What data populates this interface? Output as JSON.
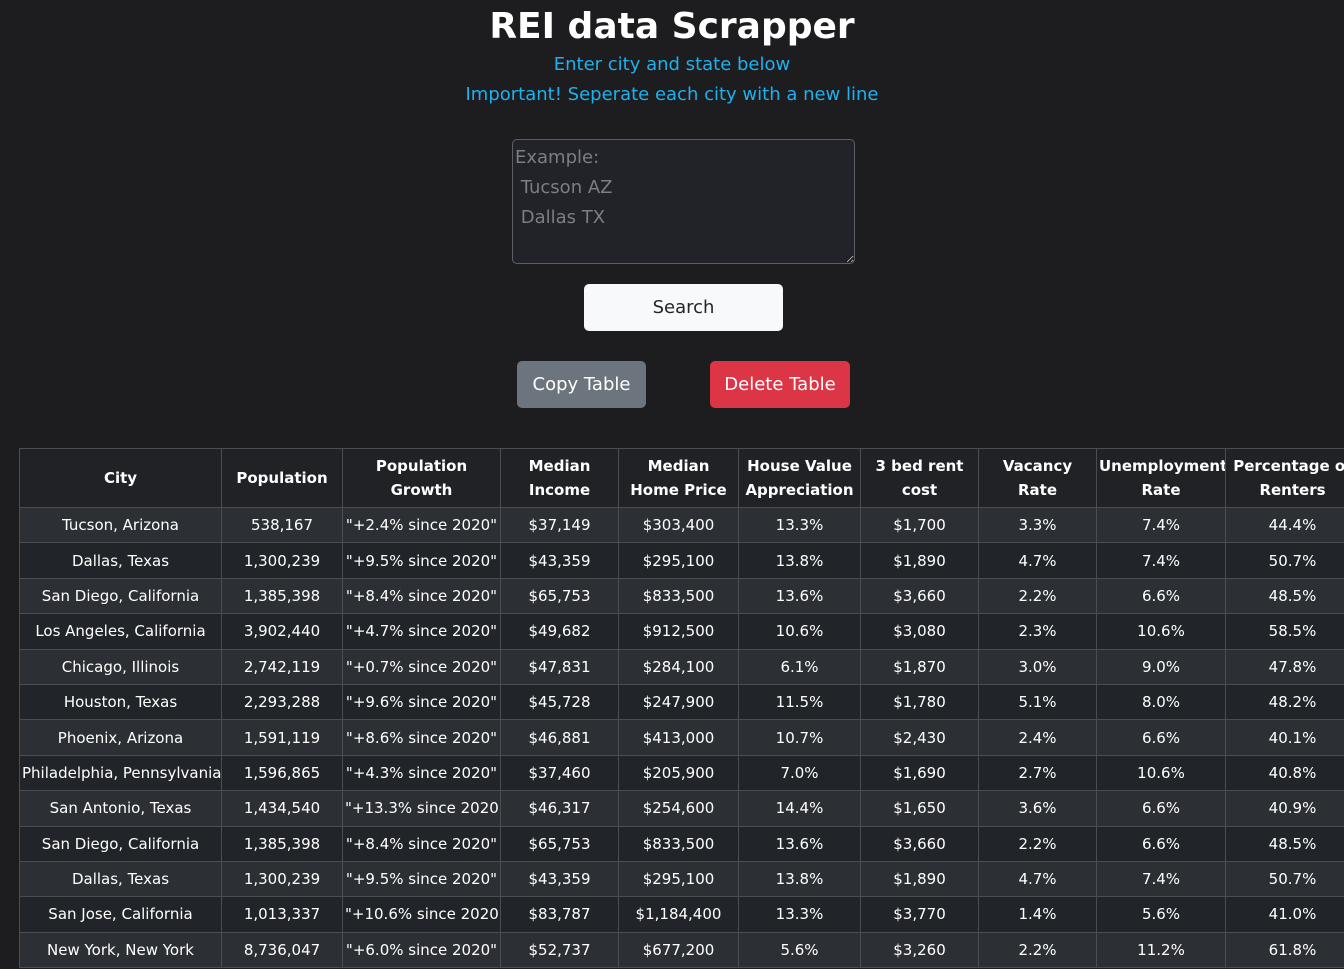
{
  "header": {
    "title": "REI data Scrapper",
    "subtitle": "Enter city and state below",
    "instruction": "Important! Seperate each city with a new line"
  },
  "input": {
    "value": "",
    "placeholder": "Example:\n Tucson AZ\n Dallas TX"
  },
  "buttons": {
    "search": "Search",
    "copy": "Copy Table",
    "delete": "Delete Table"
  },
  "colors": {
    "accent": "#1fb1ee",
    "copy_button": "#6c757d",
    "delete_button": "#dc3545",
    "search_button": "#f8f9fa",
    "background": "#1d1c1e"
  },
  "table": {
    "columns": [
      "City",
      "Population",
      "Population Growth",
      "Median Income",
      "Median Home Price",
      "House Value Appreciation",
      "3 bed rent cost",
      "Vacancy Rate",
      "Unemployment Rate",
      "Percentage of Renters"
    ],
    "rows": [
      [
        "Tucson, Arizona",
        "538,167",
        "\"+2.4% since 2020\"",
        "$37,149",
        "$303,400",
        "13.3%",
        "$1,700",
        "3.3%",
        "7.4%",
        "44.4%"
      ],
      [
        "Dallas, Texas",
        "1,300,239",
        "\"+9.5% since 2020\"",
        "$43,359",
        "$295,100",
        "13.8%",
        "$1,890",
        "4.7%",
        "7.4%",
        "50.7%"
      ],
      [
        "San Diego, California",
        "1,385,398",
        "\"+8.4% since 2020\"",
        "$65,753",
        "$833,500",
        "13.6%",
        "$3,660",
        "2.2%",
        "6.6%",
        "48.5%"
      ],
      [
        "Los Angeles, California",
        "3,902,440",
        "\"+4.7% since 2020\"",
        "$49,682",
        "$912,500",
        "10.6%",
        "$3,080",
        "2.3%",
        "10.6%",
        "58.5%"
      ],
      [
        "Chicago, Illinois",
        "2,742,119",
        "\"+0.7% since 2020\"",
        "$47,831",
        "$284,100",
        "6.1%",
        "$1,870",
        "3.0%",
        "9.0%",
        "47.8%"
      ],
      [
        "Houston, Texas",
        "2,293,288",
        "\"+9.6% since 2020\"",
        "$45,728",
        "$247,900",
        "11.5%",
        "$1,780",
        "5.1%",
        "8.0%",
        "48.2%"
      ],
      [
        "Phoenix, Arizona",
        "1,591,119",
        "\"+8.6% since 2020\"",
        "$46,881",
        "$413,000",
        "10.7%",
        "$2,430",
        "2.4%",
        "6.6%",
        "40.1%"
      ],
      [
        "Philadelphia, Pennsylvania",
        "1,596,865",
        "\"+4.3% since 2020\"",
        "$37,460",
        "$205,900",
        "7.0%",
        "$1,690",
        "2.7%",
        "10.6%",
        "40.8%"
      ],
      [
        "San Antonio, Texas",
        "1,434,540",
        "\"+13.3% since 2020\"",
        "$46,317",
        "$254,600",
        "14.4%",
        "$1,650",
        "3.6%",
        "6.6%",
        "40.9%"
      ],
      [
        "San Diego, California",
        "1,385,398",
        "\"+8.4% since 2020\"",
        "$65,753",
        "$833,500",
        "13.6%",
        "$3,660",
        "2.2%",
        "6.6%",
        "48.5%"
      ],
      [
        "Dallas, Texas",
        "1,300,239",
        "\"+9.5% since 2020\"",
        "$43,359",
        "$295,100",
        "13.8%",
        "$1,890",
        "4.7%",
        "7.4%",
        "50.7%"
      ],
      [
        "San Jose, California",
        "1,013,337",
        "\"+10.6% since 2020\"",
        "$83,787",
        "$1,184,400",
        "13.3%",
        "$3,770",
        "1.4%",
        "5.6%",
        "41.0%"
      ],
      [
        "New York, New York",
        "8,736,047",
        "\"+6.0% since 2020\"",
        "$52,737",
        "$677,200",
        "5.6%",
        "$3,260",
        "2.2%",
        "11.2%",
        "61.8%"
      ]
    ]
  }
}
